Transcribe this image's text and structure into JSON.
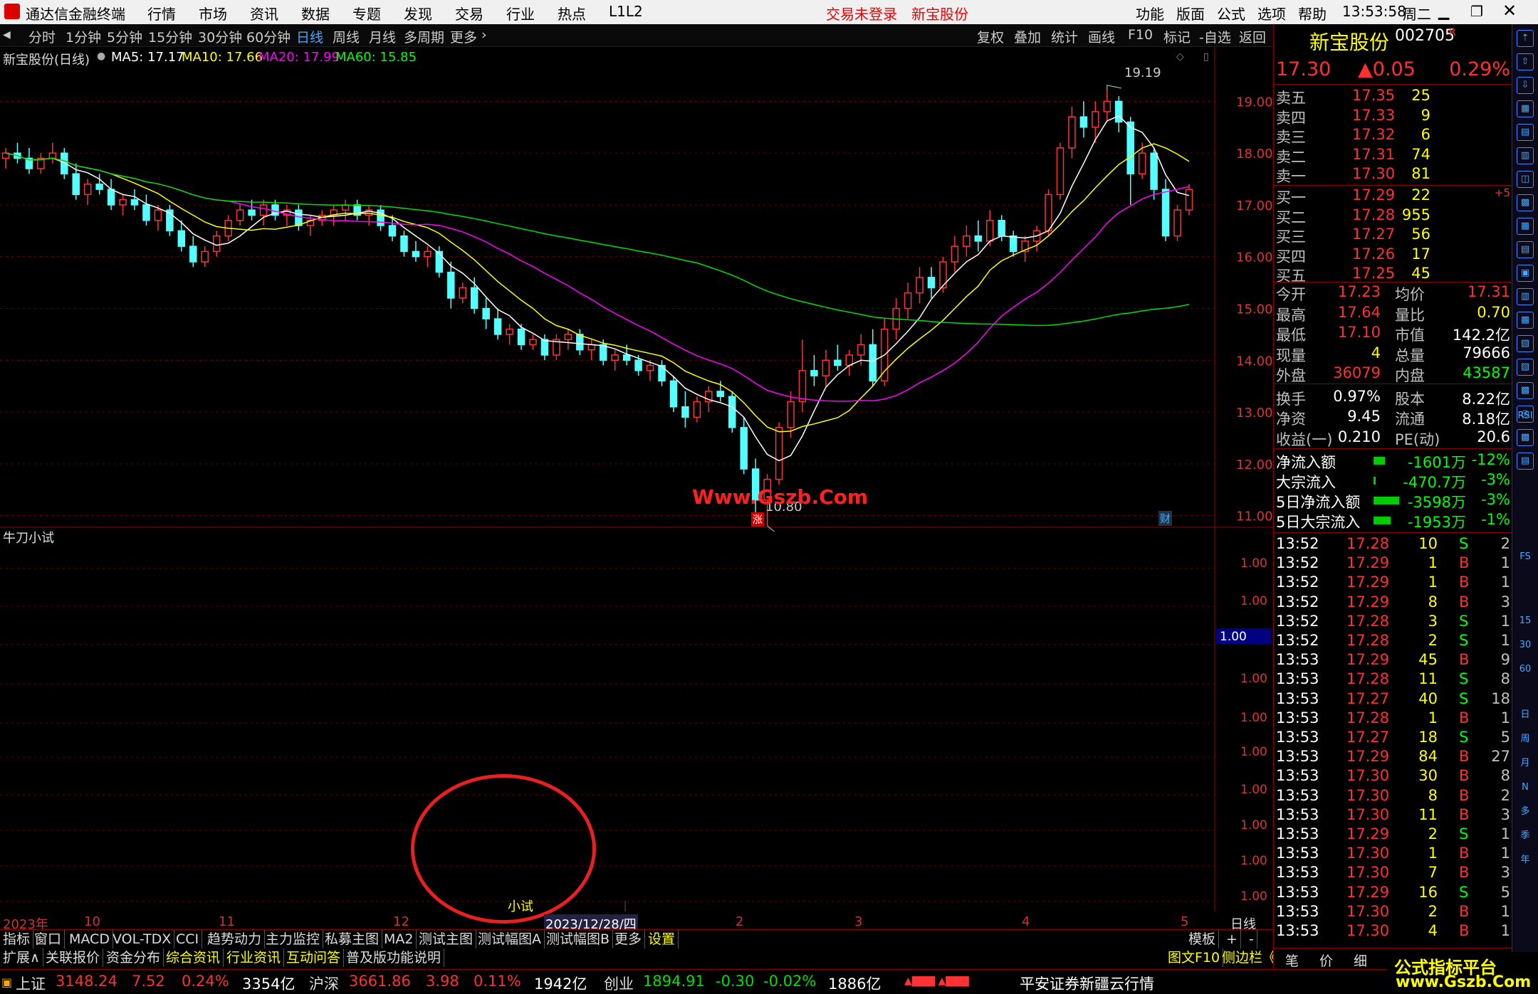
{
  "app": {
    "title": "通达信金融终端",
    "menus": [
      "行情",
      "市场",
      "资讯",
      "数据",
      "专题",
      "发现",
      "交易",
      "行业",
      "热点",
      "L1L2"
    ],
    "status_login": "交易未登录",
    "stock_in_title": "新宝股份",
    "right_menus": [
      "功能",
      "版面",
      "公式",
      "选项",
      "帮助"
    ],
    "time": "13:53:58",
    "weekday": "周二"
  },
  "periods": {
    "items": [
      "分时",
      "1分钟",
      "5分钟",
      "15分钟",
      "30分钟",
      "60分钟",
      "日线",
      "周线",
      "月线",
      "多周期",
      "更多"
    ],
    "active": "日线",
    "tools": [
      "复权",
      "叠加",
      "统计",
      "画线",
      "F10",
      "标记",
      "-自选",
      "返回"
    ]
  },
  "chart_header": {
    "name": "新宝股份(日线)",
    "ma5": "MA5: 17.17",
    "ma10": "MA10: 17.66",
    "ma20": "MA20: 17.99",
    "ma60": "MA60: 15.85"
  },
  "chart_data": {
    "type": "candlestick",
    "y_ticks": [
      "19.00",
      "18.00",
      "17.00",
      "16.00",
      "15.00",
      "14.00",
      "13.00",
      "12.00",
      "11.00"
    ],
    "ylim": [
      10.5,
      19.5
    ],
    "high_label": "19.19",
    "low_label": "10.80",
    "x_labels": [
      "2023年",
      "10",
      "11",
      "12",
      "2023/12/28/四",
      "2",
      "3",
      "4",
      "5"
    ],
    "candles": [
      [
        17.9,
        18.1,
        17.7,
        18.0
      ],
      [
        18.0,
        18.2,
        17.8,
        17.9
      ],
      [
        17.9,
        18.1,
        17.6,
        17.7
      ],
      [
        17.7,
        18.0,
        17.6,
        17.9
      ],
      [
        17.9,
        18.2,
        17.8,
        18.0
      ],
      [
        18.0,
        18.1,
        17.5,
        17.6
      ],
      [
        17.6,
        17.8,
        17.1,
        17.2
      ],
      [
        17.2,
        17.5,
        17.0,
        17.4
      ],
      [
        17.4,
        17.6,
        17.2,
        17.3
      ],
      [
        17.3,
        17.5,
        16.9,
        17.0
      ],
      [
        17.0,
        17.2,
        16.8,
        17.1
      ],
      [
        17.1,
        17.3,
        16.9,
        17.0
      ],
      [
        17.0,
        17.2,
        16.6,
        16.7
      ],
      [
        16.7,
        17.0,
        16.5,
        16.9
      ],
      [
        16.9,
        17.0,
        16.4,
        16.5
      ],
      [
        16.5,
        16.7,
        16.1,
        16.2
      ],
      [
        16.2,
        16.4,
        15.8,
        15.9
      ],
      [
        15.9,
        16.2,
        15.8,
        16.1
      ],
      [
        16.1,
        16.5,
        16.0,
        16.4
      ],
      [
        16.4,
        16.8,
        16.3,
        16.7
      ],
      [
        16.7,
        17.0,
        16.6,
        16.9
      ],
      [
        16.9,
        17.1,
        16.7,
        16.8
      ],
      [
        16.8,
        17.1,
        16.6,
        17.0
      ],
      [
        17.0,
        17.1,
        16.7,
        16.8
      ],
      [
        16.8,
        17.0,
        16.6,
        16.9
      ],
      [
        16.9,
        17.0,
        16.5,
        16.6
      ],
      [
        16.6,
        16.8,
        16.4,
        16.7
      ],
      [
        16.7,
        16.9,
        16.6,
        16.8
      ],
      [
        16.8,
        17.0,
        16.6,
        16.9
      ],
      [
        16.9,
        17.1,
        16.7,
        17.0
      ],
      [
        17.0,
        17.1,
        16.7,
        16.8
      ],
      [
        16.8,
        17.0,
        16.6,
        16.9
      ],
      [
        16.9,
        17.0,
        16.5,
        16.6
      ],
      [
        16.6,
        16.8,
        16.3,
        16.4
      ],
      [
        16.4,
        16.5,
        16.0,
        16.1
      ],
      [
        16.1,
        16.3,
        15.9,
        16.0
      ],
      [
        16.0,
        16.2,
        15.8,
        16.1
      ],
      [
        16.1,
        16.2,
        15.6,
        15.7
      ],
      [
        15.7,
        15.9,
        15.0,
        15.2
      ],
      [
        15.2,
        15.5,
        15.1,
        15.4
      ],
      [
        15.4,
        15.6,
        14.9,
        15.0
      ],
      [
        15.0,
        15.2,
        14.6,
        14.8
      ],
      [
        14.8,
        15.0,
        14.4,
        14.5
      ],
      [
        14.5,
        14.7,
        14.3,
        14.6
      ],
      [
        14.6,
        14.7,
        14.2,
        14.3
      ],
      [
        14.3,
        14.5,
        14.2,
        14.4
      ],
      [
        14.4,
        14.5,
        14.0,
        14.1
      ],
      [
        14.1,
        14.5,
        14.0,
        14.4
      ],
      [
        14.4,
        14.6,
        14.2,
        14.5
      ],
      [
        14.5,
        14.6,
        14.1,
        14.2
      ],
      [
        14.2,
        14.4,
        14.0,
        14.3
      ],
      [
        14.3,
        14.4,
        13.9,
        14.0
      ],
      [
        14.0,
        14.2,
        13.8,
        14.1
      ],
      [
        14.1,
        14.3,
        13.9,
        14.0
      ],
      [
        14.0,
        14.1,
        13.7,
        13.8
      ],
      [
        13.8,
        14.0,
        13.6,
        13.9
      ],
      [
        13.9,
        14.0,
        13.5,
        13.6
      ],
      [
        13.6,
        13.7,
        13.0,
        13.1
      ],
      [
        13.1,
        13.4,
        12.7,
        12.9
      ],
      [
        12.9,
        13.3,
        12.8,
        13.2
      ],
      [
        13.2,
        13.5,
        13.0,
        13.4
      ],
      [
        13.4,
        13.6,
        13.2,
        13.3
      ],
      [
        13.3,
        13.4,
        12.6,
        12.7
      ],
      [
        12.7,
        12.9,
        11.8,
        11.9
      ],
      [
        11.9,
        12.1,
        11.0,
        11.3
      ],
      [
        11.3,
        11.8,
        10.8,
        11.7
      ],
      [
        11.7,
        12.8,
        11.6,
        12.7
      ],
      [
        12.7,
        13.4,
        12.5,
        13.2
      ],
      [
        13.2,
        14.4,
        13.0,
        13.8
      ],
      [
        13.8,
        14.1,
        13.5,
        13.7
      ],
      [
        13.7,
        14.2,
        13.5,
        14.0
      ],
      [
        14.0,
        14.3,
        13.8,
        13.9
      ],
      [
        13.9,
        14.2,
        13.7,
        14.1
      ],
      [
        14.1,
        14.5,
        13.9,
        14.3
      ],
      [
        14.3,
        14.6,
        13.5,
        13.6
      ],
      [
        13.6,
        14.8,
        13.5,
        14.6
      ],
      [
        14.6,
        15.2,
        14.4,
        15.0
      ],
      [
        15.0,
        15.5,
        14.8,
        15.3
      ],
      [
        15.3,
        15.8,
        15.1,
        15.6
      ],
      [
        15.6,
        15.8,
        15.2,
        15.4
      ],
      [
        15.4,
        16.0,
        15.3,
        15.9
      ],
      [
        15.9,
        16.4,
        15.7,
        16.2
      ],
      [
        16.2,
        16.6,
        16.0,
        16.4
      ],
      [
        16.4,
        16.7,
        16.1,
        16.3
      ],
      [
        16.3,
        16.9,
        16.2,
        16.7
      ],
      [
        16.7,
        16.8,
        16.3,
        16.4
      ],
      [
        16.4,
        16.5,
        16.0,
        16.1
      ],
      [
        16.1,
        16.4,
        15.9,
        16.3
      ],
      [
        16.3,
        16.6,
        16.1,
        16.5
      ],
      [
        16.5,
        17.3,
        16.4,
        17.2
      ],
      [
        17.2,
        18.2,
        17.1,
        18.1
      ],
      [
        18.1,
        18.9,
        17.9,
        18.7
      ],
      [
        18.7,
        19.0,
        18.3,
        18.5
      ],
      [
        18.5,
        19.0,
        18.2,
        18.8
      ],
      [
        18.8,
        19.2,
        18.6,
        19.0
      ],
      [
        19.0,
        19.1,
        18.4,
        18.6
      ],
      [
        18.6,
        18.7,
        17.0,
        17.6
      ],
      [
        17.6,
        18.2,
        17.5,
        18.0
      ],
      [
        18.0,
        18.1,
        17.1,
        17.3
      ],
      [
        17.3,
        17.5,
        16.3,
        16.4
      ],
      [
        16.4,
        17.0,
        16.3,
        16.9
      ],
      [
        16.9,
        17.4,
        16.8,
        17.3
      ]
    ],
    "indicator_name": "牛刀小试",
    "indicator_ticks": [
      "1.00",
      "1.00",
      "1.00",
      "1.00",
      "1.00",
      "1.00",
      "1.00",
      "1.00",
      "1.00",
      "1.00"
    ],
    "indicator_highlight": "1.00",
    "indicator_label": "小试",
    "fin_mark": "财",
    "up_mark": "涨"
  },
  "watermark": "Www.Gszb.Com",
  "quote": {
    "name": "新宝股份",
    "code": "002705",
    "flag": "R",
    "price": "17.30",
    "change": "▲0.05",
    "pct": "0.29%",
    "sells": [
      [
        "卖五",
        "17.35",
        "25"
      ],
      [
        "卖四",
        "17.33",
        "9"
      ],
      [
        "卖三",
        "17.32",
        "6"
      ],
      [
        "卖二",
        "17.31",
        "74"
      ],
      [
        "卖一",
        "17.30",
        "81"
      ]
    ],
    "buys": [
      [
        "买一",
        "17.29",
        "22",
        "+5"
      ],
      [
        "买二",
        "17.28",
        "955",
        ""
      ],
      [
        "买三",
        "17.27",
        "56",
        ""
      ],
      [
        "买四",
        "17.26",
        "17",
        ""
      ],
      [
        "买五",
        "17.25",
        "45",
        ""
      ]
    ],
    "stats": [
      [
        "今开",
        "17.23",
        "均价",
        "17.31"
      ],
      [
        "最高",
        "17.64",
        "量比",
        "0.70"
      ],
      [
        "最低",
        "17.10",
        "市值",
        "142.2亿"
      ],
      [
        "现量",
        "4",
        "总量",
        "79666"
      ],
      [
        "外盘",
        "36079",
        "内盘",
        "43587"
      ],
      [
        "换手",
        "0.97%",
        "股本",
        "8.22亿"
      ],
      [
        "净资",
        "9.45",
        "流通",
        "8.18亿"
      ],
      [
        "收益(一)",
        "0.210",
        "PE(动)",
        "20.6"
      ]
    ],
    "flows": [
      [
        "净流入额",
        "-1601万",
        "-12%"
      ],
      [
        "大宗流入",
        "-470.7万",
        "-3%"
      ],
      [
        "5日净流入额",
        "-3598万",
        "-3%"
      ],
      [
        "5日大宗流入",
        "-1953万",
        "-1%"
      ]
    ],
    "ticks": [
      [
        "13:52",
        "17.28",
        "10",
        "S",
        "2"
      ],
      [
        "13:52",
        "17.29",
        "1",
        "B",
        "1"
      ],
      [
        "13:52",
        "17.29",
        "1",
        "B",
        "1"
      ],
      [
        "13:52",
        "17.29",
        "8",
        "B",
        "3"
      ],
      [
        "13:52",
        "17.28",
        "3",
        "S",
        "1"
      ],
      [
        "13:52",
        "17.28",
        "2",
        "S",
        "1"
      ],
      [
        "13:53",
        "17.29",
        "45",
        "B",
        "9"
      ],
      [
        "13:53",
        "17.28",
        "11",
        "S",
        "8"
      ],
      [
        "13:53",
        "17.27",
        "40",
        "S",
        "18"
      ],
      [
        "13:53",
        "17.28",
        "1",
        "B",
        "1"
      ],
      [
        "13:53",
        "17.27",
        "18",
        "S",
        "5"
      ],
      [
        "13:53",
        "17.29",
        "84",
        "B",
        "27"
      ],
      [
        "13:53",
        "17.30",
        "30",
        "B",
        "8"
      ],
      [
        "13:53",
        "17.30",
        "8",
        "B",
        "2"
      ],
      [
        "13:53",
        "17.30",
        "11",
        "B",
        "3"
      ],
      [
        "13:53",
        "17.29",
        "2",
        "S",
        "1"
      ],
      [
        "13:53",
        "17.30",
        "1",
        "B",
        "1"
      ],
      [
        "13:53",
        "17.30",
        "7",
        "B",
        "3"
      ],
      [
        "13:53",
        "17.29",
        "16",
        "S",
        "5"
      ],
      [
        "13:53",
        "17.30",
        "2",
        "B",
        "1"
      ],
      [
        "13:53",
        "17.30",
        "4",
        "B",
        "1"
      ]
    ],
    "bottom_tabs": [
      "笔",
      "价",
      "细",
      "势"
    ]
  },
  "tabs1": [
    "指标",
    "窗口",
    "MACD",
    "VOL-TDX",
    "CCI",
    "趋势动力",
    "主力监控",
    "私募主图",
    "MA2",
    "测试主图",
    "测试幅图A",
    "测试幅图B",
    "更多",
    "设置"
  ],
  "tabs1_right": [
    "模板",
    "+",
    "-"
  ],
  "tabs2": [
    "扩展∧",
    "关联报价",
    "资金分布",
    "综合资讯",
    "行业资讯",
    "互动问答",
    "普及版功能说明"
  ],
  "tabs2_right": [
    "图文F10",
    "侧边栏《"
  ],
  "cycle_label": "日线",
  "tool_labels": [
    "日",
    "周",
    "月",
    "N",
    "多",
    "季",
    "年",
    "RSI",
    "FS",
    "15",
    "30",
    "60"
  ],
  "statusbar": {
    "sh": "上证",
    "sh_val": "3148.24",
    "sh_chg": "7.52",
    "sh_pct": "0.24%",
    "sh_amt": "3354亿",
    "sz": "沪深",
    "sz_val": "3661.86",
    "sz_chg": "3.98",
    "sz_pct": "0.11%",
    "sz_amt": "1942亿",
    "cy": "创业",
    "cy_val": "1894.91",
    "cy_chg": "-0.30",
    "cy_pct": "-0.02%",
    "cy_amt": "1886亿",
    "broker": "平安证券新疆云行情",
    "brand1": "公式指标平台",
    "brand2": "www.Gszb.Com"
  }
}
